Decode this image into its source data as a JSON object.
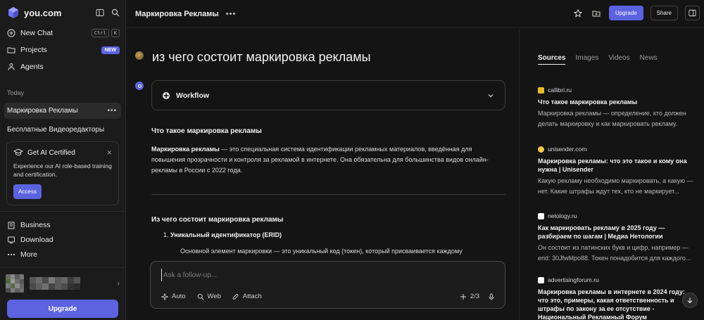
{
  "brand": {
    "name": "you.com",
    "accent": "#5b63e0"
  },
  "sidebar": {
    "nav": [
      {
        "label": "New Chat",
        "icon": "plus-circle-icon",
        "shortcut": [
          "Ctrl",
          "K"
        ]
      },
      {
        "label": "Projects",
        "icon": "folder-icon",
        "badge": "NEW"
      },
      {
        "label": "Agents",
        "icon": "agents-icon"
      }
    ],
    "section_today": "Today",
    "chats": [
      {
        "label": "Маркировка Рекламы",
        "active": true
      },
      {
        "label": "Бесплатные Видеоредакторы",
        "active": false
      }
    ],
    "promo": {
      "title": "Get AI Certified",
      "text": "Experience our AI role-based training and certification.",
      "button": "Access"
    },
    "bottom_nav": [
      {
        "label": "Business",
        "icon": "business-icon"
      },
      {
        "label": "Download",
        "icon": "download-icon"
      },
      {
        "label": "More",
        "icon": "more-icon"
      }
    ],
    "upgrade": "Upgrade"
  },
  "header": {
    "title": "Маркировка Рекламы",
    "upgrade": "Upgrade",
    "share": "Share"
  },
  "thread": {
    "question": "из чего состоит маркировка рекламы",
    "workflow_label": "Workflow",
    "heading1": "Что такое маркировка рекламы",
    "para_bold": "Маркировка рекламы",
    "para_rest": " — это специальная система идентификации рекламных материалов, введённая для повышения прозрачности и контроля за рекламой в интернете. Она обязательна для большинства видов онлайн-рекламы в России с 2022 года.",
    "heading2": "Из чего состоит маркировка рекламы",
    "list_num": "1.",
    "list_item_bold": "Уникальный идентификатор (ERID)",
    "sub_item": "Основной элемент маркировки — это уникальный код (токен), который присваивается каждому"
  },
  "composer": {
    "placeholder": "Ask a follow-up...",
    "tools": [
      "Auto",
      "Web",
      "Attach"
    ],
    "counter": "2/3"
  },
  "sources_panel": {
    "tabs": [
      "Sources",
      "Images",
      "Videos",
      "News"
    ],
    "active_tab": "Sources",
    "sources": [
      {
        "domain": "callibri.ru",
        "favicon_color": "#e8b923",
        "title": "Что такое маркировка рекламы",
        "snippet": "Маркировка рекламы — определение, кто должен делать маркировку и как маркировать рекламу."
      },
      {
        "domain": "unisender.com",
        "favicon_color": "#f2c94c",
        "title": "Маркировка рекламы: что это такое и кому она нужна | Unisender",
        "snippet": "Какую рекламу необходимо маркировать, а какую — нет. Какие штрафы ждут тех, кто не маркирует..."
      },
      {
        "domain": "netology.ru",
        "favicon_color": "#ffffff",
        "title": "Как маркировать рекламу в 2025 году — разбираем по шагам | Медиа Нетологии",
        "snippet": "Он состоит из латинских букв и цифр, например — erid: 30JfwMpo88. Токен понадобится для каждого..."
      },
      {
        "domain": "advertisingforum.ru",
        "favicon_color": "#ffffff",
        "title": "Маркировка рекламы в интернете в 2024 году: что это, примеры, какая ответственность и штрафы по закону за ее отсутствие - Национальный Рекламный Форум",
        "snippet": ""
      }
    ]
  }
}
